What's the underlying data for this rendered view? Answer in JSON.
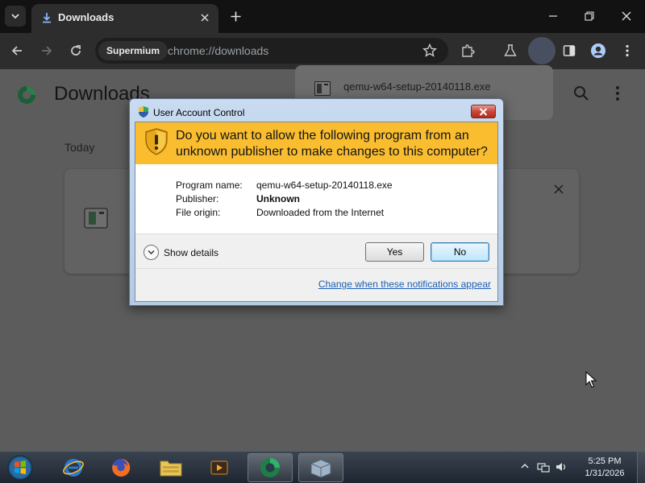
{
  "browser": {
    "tab_title": "Downloads",
    "omnibox_chip": "Supermium",
    "omnibox_url": "chrome://downloads"
  },
  "downloads_page": {
    "title": "Downloads",
    "section_date": "Today"
  },
  "download_bubble": {
    "filename": "qemu-w64-setup-20140118.exe"
  },
  "uac": {
    "title": "User Account Control",
    "question": "Do you want to allow the following program from an unknown publisher to make changes to this computer?",
    "details": [
      {
        "label": "Program name:",
        "value": "qemu-w64-setup-20140118.exe"
      },
      {
        "label": "Publisher:",
        "value": "Unknown"
      },
      {
        "label": "File origin:",
        "value": "Downloaded from the Internet"
      }
    ],
    "show_details": "Show details",
    "yes_label": "Yes",
    "no_label": "No",
    "link": "Change when these notifications appear",
    "banner_color": "#f9bd2f"
  },
  "taskbar": {
    "apps": [
      "internet-explorer",
      "firefox",
      "file-explorer",
      "media-player",
      "supermium",
      "setup-installer"
    ],
    "clock_time": "5:25 PM",
    "clock_date": "1/31/2026"
  }
}
